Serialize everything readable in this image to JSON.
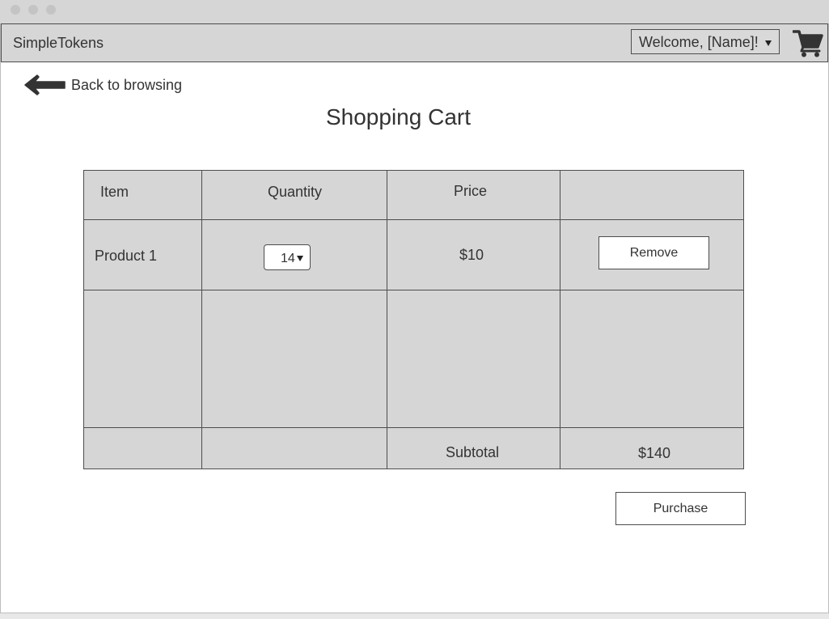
{
  "app": {
    "brand": "SimpleTokens"
  },
  "header": {
    "user_menu_label": "Welcome, [Name]!"
  },
  "nav": {
    "back_label": "Back to browsing"
  },
  "page": {
    "title": "Shopping Cart"
  },
  "cart_table": {
    "columns": [
      "Item",
      "Quantity",
      "Price",
      ""
    ],
    "rows": [
      {
        "item": "Product 1",
        "quantity": "14",
        "price": "$10",
        "action_label": "Remove"
      }
    ],
    "subtotal_label": "Subtotal",
    "subtotal_value": "$140"
  },
  "actions": {
    "purchase_label": "Purchase"
  },
  "icons": {
    "cart": "shopping-cart-icon",
    "back": "arrow-left-icon",
    "caret": "chevron-down-icon"
  },
  "colors": {
    "panel_gray": "#d6d6d6",
    "border": "#4d4d4d",
    "text": "#333333",
    "button_bg": "#ffffff"
  }
}
